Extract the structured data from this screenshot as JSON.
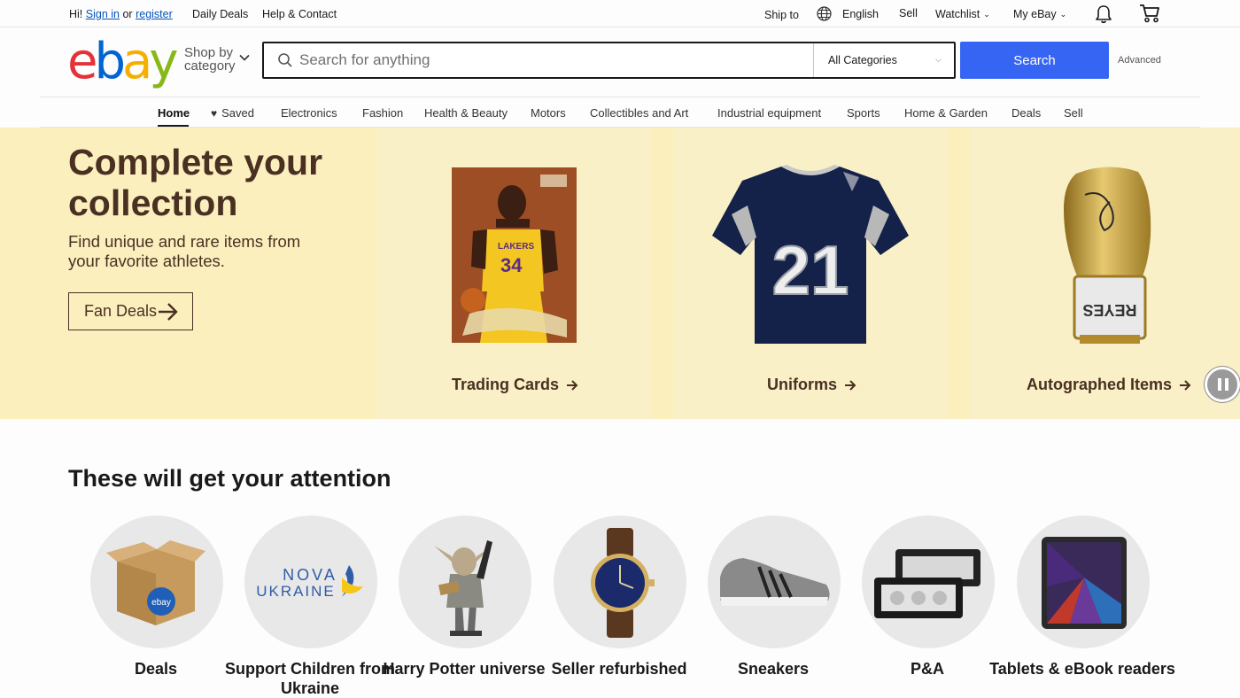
{
  "topbar": {
    "greeting": "Hi!",
    "sign_in": "Sign in",
    "or": "or",
    "register": "register",
    "daily_deals": "Daily Deals",
    "help": "Help & Contact",
    "ship_to": "Ship to",
    "language": "English",
    "sell": "Sell",
    "watchlist": "Watchlist",
    "my_ebay": "My eBay"
  },
  "header": {
    "logo_letters": [
      "e",
      "b",
      "a",
      "y"
    ],
    "logo_colors": [
      "#e53238",
      "#0064d2",
      "#f5af02",
      "#86b817"
    ],
    "shop_by_line1": "Shop by",
    "shop_by_line2": "category",
    "search_placeholder": "Search for anything",
    "category_select": "All Categories",
    "search_button": "Search",
    "advanced": "Advanced"
  },
  "nav": {
    "items": [
      "Home",
      "Saved",
      "Electronics",
      "Fashion",
      "Health & Beauty",
      "Motors",
      "Collectibles and Art",
      "Industrial equipment",
      "Sports",
      "Home & Garden",
      "Deals",
      "Sell"
    ]
  },
  "hero": {
    "title": "Complete your collection",
    "subtitle": "Find unique and rare items from your favorite athletes.",
    "button": "Fan Deals",
    "panels": [
      "Trading Cards",
      "Uniforms",
      "Autographed Items"
    ],
    "jersey_number": "21",
    "card_number": "34"
  },
  "attention": {
    "title": "These will get your attention",
    "categories": [
      "Deals",
      "Support Children from Ukraine",
      "Harry Potter universe",
      "Seller refurbished",
      "Sneakers",
      "P&A",
      "Tablets & eBook readers"
    ],
    "nova_line1": "NOVA",
    "nova_line2": "UKRAINE",
    "box_badge": "ebay"
  }
}
